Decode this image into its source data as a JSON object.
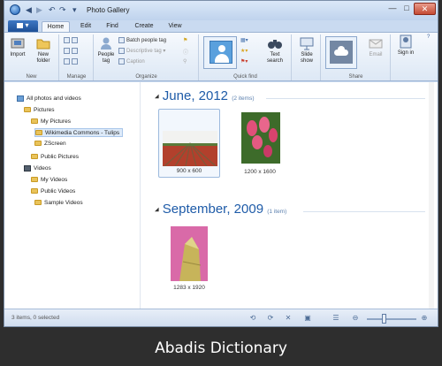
{
  "window": {
    "title": "Photo Gallery"
  },
  "menu": {
    "file_label": "▾",
    "tabs": [
      "Home",
      "Edit",
      "Find",
      "Create",
      "View"
    ],
    "active_tab": "Home"
  },
  "ribbon": {
    "groups": [
      "New",
      "Manage",
      "Organize",
      "Quick find",
      "Share"
    ],
    "import_label": "Import",
    "new_folder_label": "New folder",
    "people_tag_label": "People tag",
    "batch_people_tag": "Batch people tag",
    "descriptive_tag": "Descriptive tag",
    "caption": "Caption",
    "text_search_label": "Text search",
    "slide_show_label": "Slide show",
    "email_label": "Email",
    "sign_in_label": "Sign in"
  },
  "nav": {
    "items": [
      {
        "label": "All photos and videos",
        "icon": "pc-icon"
      },
      {
        "label": "Pictures",
        "icon": "folder-icon"
      },
      {
        "label": "My Pictures",
        "icon": "folder-icon"
      },
      {
        "label": "Wikimedia Commons - Tulips",
        "icon": "folder-icon",
        "selected": true
      },
      {
        "label": "ZScreen",
        "icon": "folder-icon"
      },
      {
        "label": "Public Pictures",
        "icon": "folder-icon"
      },
      {
        "label": "Videos",
        "icon": "video-icon"
      },
      {
        "label": "My Videos",
        "icon": "folder-icon"
      },
      {
        "label": "Public Videos",
        "icon": "folder-icon"
      },
      {
        "label": "Sample Videos",
        "icon": "folder-icon"
      }
    ]
  },
  "gallery": {
    "groups": [
      {
        "title": "June, 2012",
        "count": "(2 items)",
        "items": [
          {
            "dims": "900 x 600"
          },
          {
            "dims": "1200 x 1600"
          }
        ]
      },
      {
        "title": "September, 2009",
        "count": "(1 item)",
        "items": [
          {
            "dims": "1283 x 1920"
          }
        ]
      }
    ]
  },
  "status": {
    "text": "3 items, 0 selected"
  },
  "footer": {
    "text": "Abadis Dictionary"
  },
  "colors": {
    "accent": "#1e5ba8",
    "ribbon": "#dde8f5",
    "close": "#c44a33"
  }
}
